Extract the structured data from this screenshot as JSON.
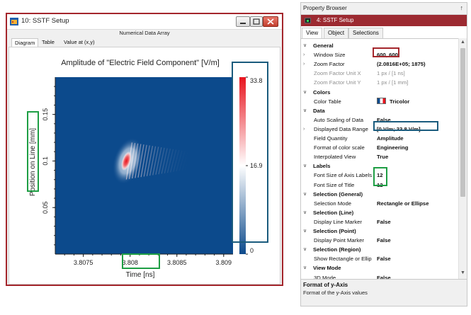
{
  "window": {
    "title": "10: SSTF Setup",
    "subheader": "Numerical Data Array",
    "tabs": [
      "Diagram",
      "Table",
      "Value at (x,y)"
    ]
  },
  "chart_data": {
    "type": "heatmap",
    "title": "Amplitude of \"Electric Field Component\"  [V/m]",
    "xlabel": "Time [ns]",
    "ylabel": "Position on Line [mm]",
    "xlim": [
      3.8072,
      3.8091
    ],
    "ylim": [
      0.0,
      0.19
    ],
    "xticks": [
      3.8075,
      3.808,
      3.8085,
      3.809
    ],
    "xtick_labels": [
      "3.8075",
      "3.808",
      "3.8085",
      "3.809"
    ],
    "yticks": [
      0.05,
      0.1,
      0.15
    ],
    "ytick_labels": [
      "0.05",
      "0.1",
      "0.15"
    ],
    "colorbar": {
      "min": 0,
      "max": 33.8,
      "ticks": [
        33.8,
        16.9,
        0
      ],
      "tick_labels": [
        "33.8",
        "16.9",
        "0"
      ]
    },
    "feature": {
      "center_x": 3.80796,
      "center_y": 0.1,
      "peak": 33.8,
      "fringe_end_x": 3.80865
    }
  },
  "panel": {
    "header": "Property Browser",
    "pin": "↑",
    "object": "4: SSTF Setup",
    "tabs": [
      "View",
      "Object",
      "Selections"
    ],
    "rows": [
      {
        "kind": "cat",
        "exp": "∨",
        "name": "General"
      },
      {
        "kind": "prop",
        "exp": "›",
        "name": "Window Size",
        "value": "600, 600",
        "bold": true
      },
      {
        "kind": "prop",
        "exp": "›",
        "name": "Zoom Factor",
        "value": "(2.0816E+05; 1875)",
        "bold": true
      },
      {
        "kind": "prop",
        "exp": "",
        "name": "Zoom Factor Unit X",
        "value": "1 px / [1 ns]",
        "disabled": true
      },
      {
        "kind": "prop",
        "exp": "",
        "name": "Zoom Factor Unit Y",
        "value": "1 px / [1 mm]",
        "disabled": true
      },
      {
        "kind": "cat",
        "exp": "∨",
        "name": "Colors"
      },
      {
        "kind": "prop",
        "exp": "",
        "name": "Color Table",
        "value": "Tricolor",
        "bold": true,
        "swatch": true
      },
      {
        "kind": "cat",
        "exp": "∨",
        "name": "Data"
      },
      {
        "kind": "prop",
        "exp": "",
        "name": "Auto Scaling of Data",
        "value": "False",
        "bold": true
      },
      {
        "kind": "prop",
        "exp": "›",
        "name": "Displayed Data Range",
        "value": "[0 V/m; 33.8 V/m]",
        "bold": true
      },
      {
        "kind": "prop",
        "exp": "",
        "name": "Field Quantity",
        "value": "Amplitude",
        "bold": true
      },
      {
        "kind": "prop",
        "exp": "",
        "name": "Format of color scale",
        "value": "Engineering",
        "bold": true
      },
      {
        "kind": "prop",
        "exp": "",
        "name": "Interpolated View",
        "value": "True",
        "bold": true
      },
      {
        "kind": "cat",
        "exp": "∨",
        "name": "Labels"
      },
      {
        "kind": "prop",
        "exp": "",
        "name": "Font Size of Axis Labels",
        "value": "12",
        "bold": true
      },
      {
        "kind": "prop",
        "exp": "",
        "name": "Font Size of Title",
        "value": "12",
        "bold": true
      },
      {
        "kind": "cat",
        "exp": "∨",
        "name": "Selection (General)"
      },
      {
        "kind": "prop",
        "exp": "",
        "name": "Selection Mode",
        "value": "Rectangle or Ellipse",
        "bold": true
      },
      {
        "kind": "cat",
        "exp": "∨",
        "name": "Selection (Line)"
      },
      {
        "kind": "prop",
        "exp": "",
        "name": "Display Line Marker",
        "value": "False",
        "bold": true
      },
      {
        "kind": "cat",
        "exp": "∨",
        "name": "Selection (Point)"
      },
      {
        "kind": "prop",
        "exp": "",
        "name": "Display Point Marker",
        "value": "False",
        "bold": true
      },
      {
        "kind": "cat",
        "exp": "∨",
        "name": "Selection (Region)"
      },
      {
        "kind": "prop",
        "exp": "",
        "name": "Show Rectangle or Ellip",
        "value": "False",
        "bold": true
      },
      {
        "kind": "cat",
        "exp": "∨",
        "name": "View Mode"
      },
      {
        "kind": "prop",
        "exp": "",
        "name": "3D Mode",
        "value": "False",
        "bold": true
      }
    ],
    "description": {
      "title": "Format of y-Axis",
      "text": "Format of the y-Axis values"
    }
  },
  "colors": {
    "window_border": "#a4262c",
    "object_bar": "#9c2a31",
    "highlight_green": "#1e9e44",
    "highlight_blue": "#1a5b7d",
    "highlight_red": "#a4262c",
    "heatmap_background": "#0c4a8c"
  },
  "icons": {
    "window": "app-icon",
    "pin": "pin-icon",
    "color_table": "tricolor-swatch-icon"
  }
}
